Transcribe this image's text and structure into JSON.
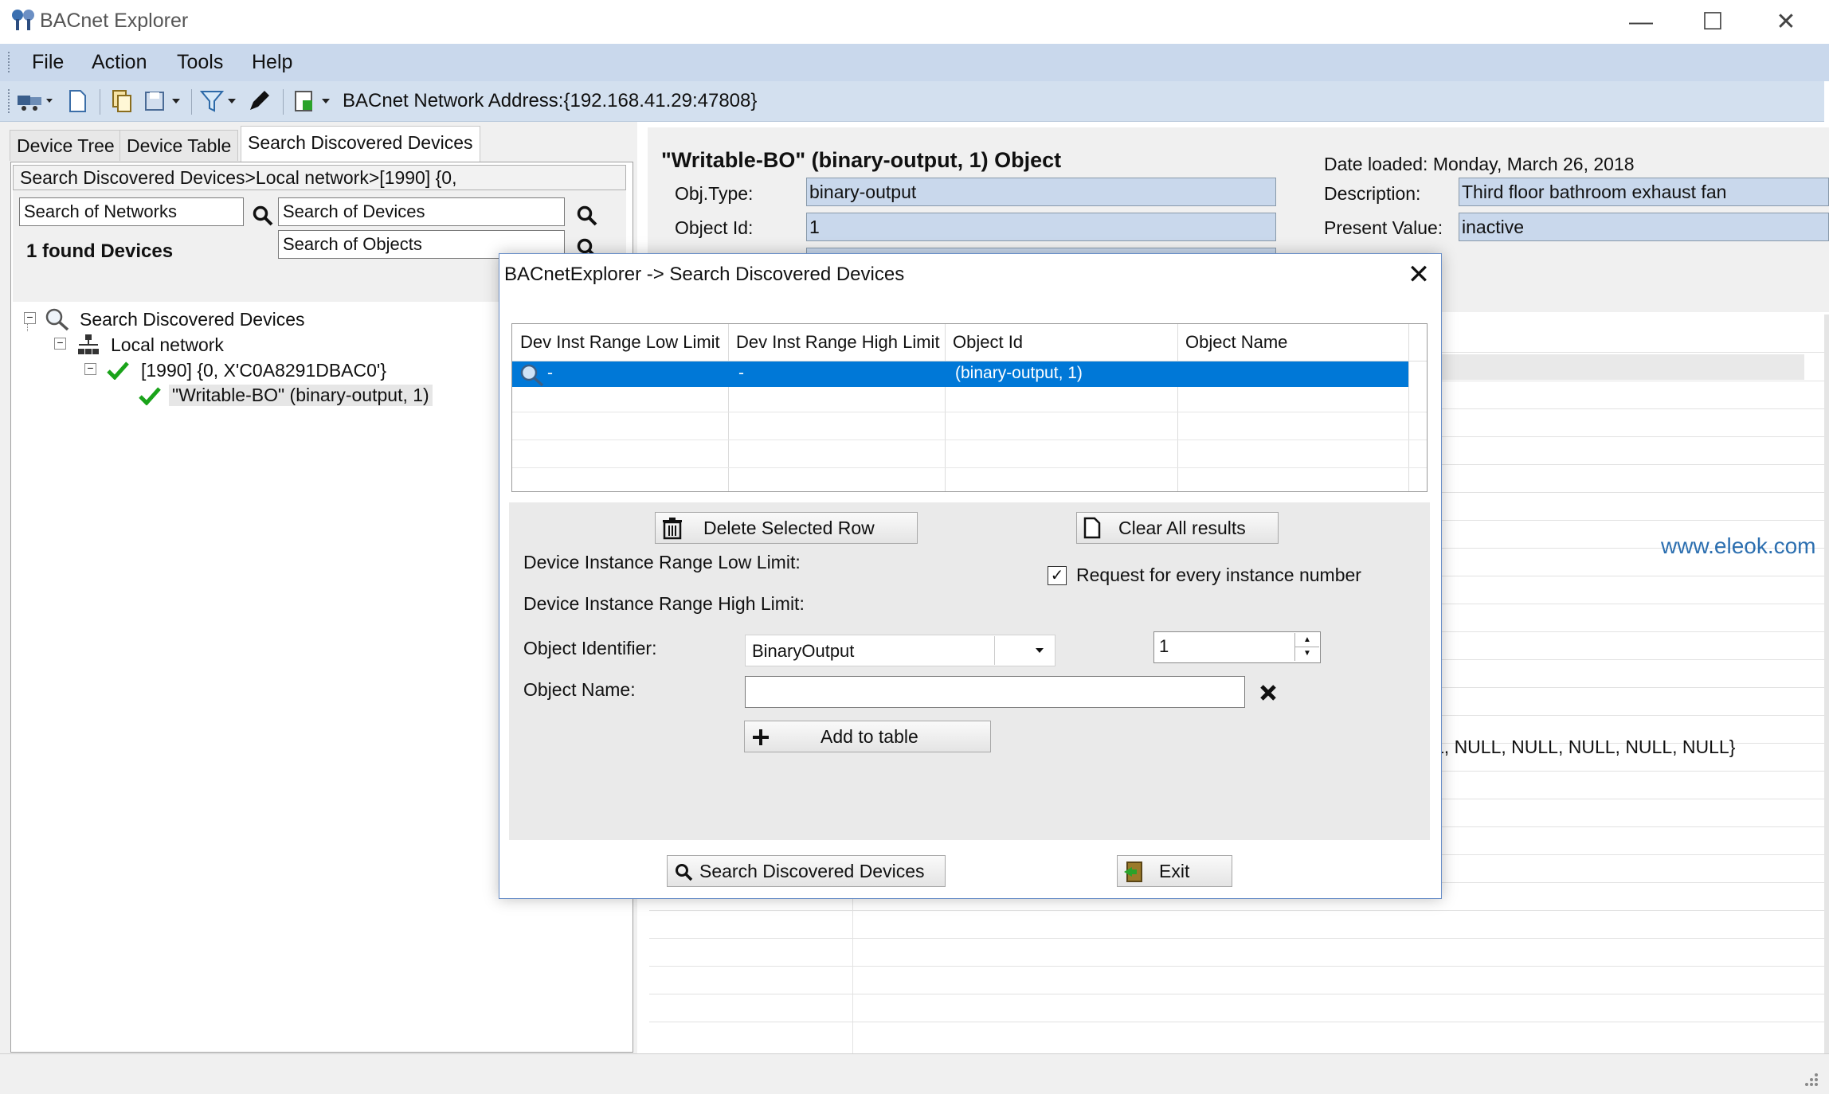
{
  "window": {
    "title": "BACnet Explorer",
    "minimize": "—",
    "maximize": "☐",
    "close": "✕"
  },
  "menu": [
    "File",
    "Action",
    "Tools",
    "Help"
  ],
  "toolbar": {
    "network_address": "BACnet Network Address:{192.168.41.29:47808}"
  },
  "left": {
    "tabs": [
      "Device Tree",
      "Device Table",
      "Search Discovered Devices"
    ],
    "active_tab": 2,
    "breadcrumb": "Search Discovered Devices>Local network>[1990] {0,",
    "search_networks_placeholder": "Search of Networks",
    "search_devices_placeholder": "Search of Devices",
    "search_objects_placeholder": "Search of Objects",
    "found_devices": "1 found Devices",
    "tree": {
      "root": "Search Discovered Devices",
      "network": "Local network",
      "device": "[1990] {0, X'C0A8291DBAC0'}",
      "object": "\"Writable-BO\" (binary-output, 1)"
    }
  },
  "right": {
    "object_title": "\"Writable-BO\" (binary-output, 1) Object",
    "date_loaded": "Date loaded: Monday, March 26, 2018",
    "obj_type_label": "Obj.Type:",
    "obj_type_value": "binary-output",
    "object_id_label": "Object Id:",
    "object_id_value": "1",
    "description_label": "Description:",
    "description_value": "Third floor bathroom exhaust fan",
    "present_value_label": "Present Value:",
    "present_value_value": "inactive",
    "null_text": "L, NULL, NULL, NULL, NULL, NULL}",
    "watermark": "www.eleok.com"
  },
  "dialog": {
    "title": "BACnetExplorer -> Search Discovered Devices",
    "columns": [
      "Dev Inst Range Low Limit",
      "Dev Inst Range High Limit",
      "Object Id",
      "Object Name"
    ],
    "rows": [
      {
        "low": "-",
        "high": "-",
        "object_id": "(binary-output, 1)",
        "object_name": ""
      }
    ],
    "delete_button": "Delete Selected Row",
    "clear_button": "Clear All results",
    "low_limit_label": "Device Instance Range Low Limit:",
    "high_limit_label": "Device Instance Range High Limit:",
    "request_checkbox_label": "Request for every instance number",
    "request_checked": true,
    "object_identifier_label": "Object Identifier:",
    "object_identifier_value": "BinaryOutput",
    "object_instance_value": "1",
    "object_name_label": "Object Name:",
    "object_name_value": "",
    "add_button": "Add to table",
    "search_button": "Search Discovered Devices",
    "exit_button": "Exit"
  },
  "colors": {
    "menu_bg": "#c9d8ec",
    "selection": "#0078d7",
    "field_bg": "#c9d8ec",
    "check_green": "#1aa31a"
  }
}
